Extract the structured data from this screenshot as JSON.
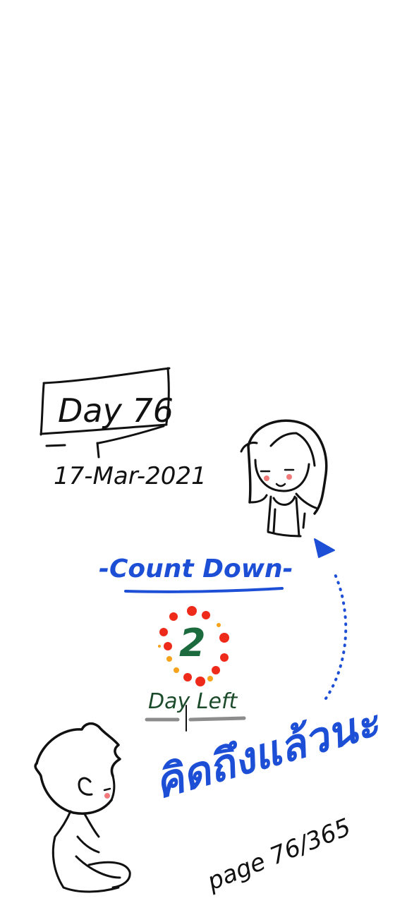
{
  "day_label": "Day 76",
  "date": "17-Mar-2021",
  "countdown_title": "-Count Down-",
  "days_number": "2",
  "days_left_label": "Day Left",
  "thai_message": "คิดถึงแล้วนะ",
  "page_label": "page 76/365",
  "colors": {
    "ink_black": "#111111",
    "ink_blue": "#1d4fd6",
    "number_green": "#1c6b3f",
    "dot_red": "#ee2a1b",
    "dot_orange": "#f7a21b",
    "blush": "#f07a7a",
    "underline_gray": "#8c8c8c"
  }
}
